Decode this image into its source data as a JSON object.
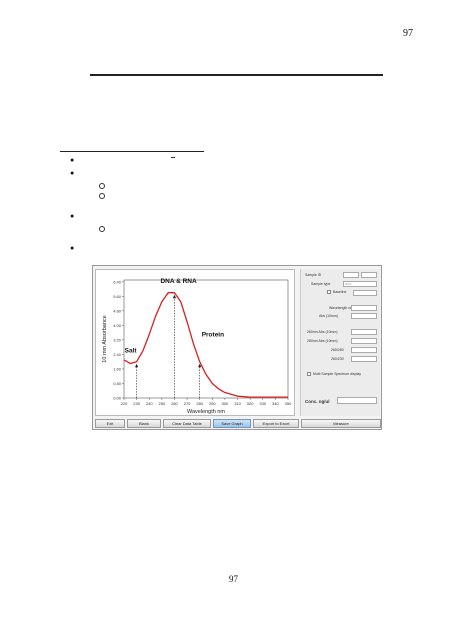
{
  "page": {
    "number_top": "97",
    "number_bottom": "97"
  },
  "figure": {
    "chart_data": {
      "type": "line",
      "x": [
        220,
        225,
        230,
        235,
        240,
        245,
        250,
        255,
        260,
        265,
        270,
        275,
        280,
        285,
        290,
        295,
        300,
        310,
        320,
        330,
        340,
        350
      ],
      "series": [
        {
          "values": [
            2.1,
            1.9,
            2.0,
            2.6,
            3.5,
            4.5,
            5.3,
            5.8,
            5.8,
            5.3,
            4.2,
            3.0,
            2.0,
            1.3,
            0.8,
            0.5,
            0.3,
            0.1,
            0.05,
            0.05,
            0.05,
            0.05
          ]
        }
      ],
      "xlabel": "Wavelength nm",
      "ylabel": "10 mm Absorbance",
      "xlim": [
        220,
        350
      ],
      "ylim": [
        0,
        6.5
      ],
      "xticks": [
        "220",
        "230",
        "240",
        "250",
        "260",
        "270",
        "280",
        "290",
        "300",
        "310",
        "320",
        "330",
        "340",
        "350"
      ],
      "yticks": [
        "0.00",
        "0.80",
        "1.60",
        "2.40",
        "3.20",
        "4.00",
        "4.80",
        "5.60",
        "6.40"
      ],
      "annotations": [
        {
          "text": "Salt",
          "x": 230
        },
        {
          "text": "DNA & RNA",
          "x": 260
        },
        {
          "text": "Protein",
          "x": 280
        }
      ],
      "line_color": "#d62020"
    },
    "panel": {
      "sample_id": "Sample ID",
      "sample_type": "Sample type",
      "sample_type_value": "RNA",
      "baseline": "Baseline",
      "wavelength": "Wavelength nm",
      "abs_10mm": "Abs (10mm)",
      "abs_260": "260nm Abs (10mm)",
      "abs_280": "280nm Abs (10mm)",
      "ratio_260_280": "260/280",
      "ratio_260_230": "260/230",
      "multi_sample": "Multi Sample Spectrum display",
      "conc": "Conc. ng/ul"
    },
    "toolbar": {
      "exit": "Exit",
      "blank": "Blank",
      "clear": "Clear Data Table",
      "save": "Save Graph",
      "export": "Export to Excel",
      "measure": "Measure"
    }
  }
}
